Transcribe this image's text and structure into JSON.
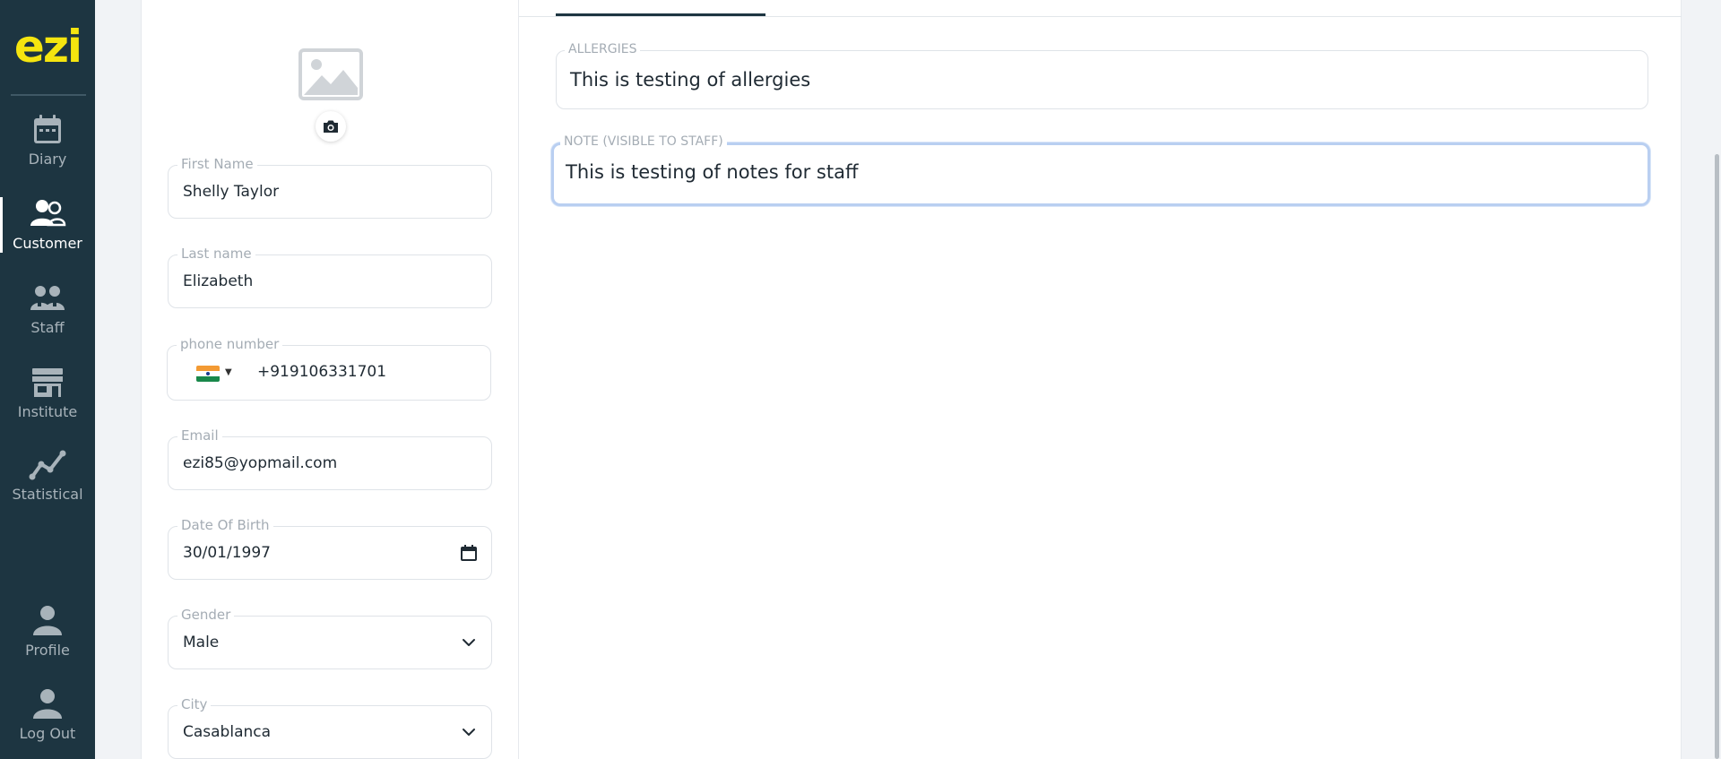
{
  "sidebar": {
    "logo": "ezi",
    "items": [
      {
        "label": "Diary",
        "icon": "calendar-icon",
        "active": false
      },
      {
        "label": "Customer",
        "icon": "users-icon",
        "active": true
      },
      {
        "label": "Staff",
        "icon": "staff-icon",
        "active": false
      },
      {
        "label": "Institute",
        "icon": "store-icon",
        "active": false
      },
      {
        "label": "Statistical",
        "icon": "chart-line-icon",
        "active": false
      },
      {
        "label": "Profile",
        "icon": "user-icon",
        "active": false
      },
      {
        "label": "Log Out",
        "icon": "user-icon",
        "active": false
      }
    ]
  },
  "customer_form": {
    "avatar_icon": "image-placeholder-icon",
    "camera_icon": "camera-icon",
    "first_name": {
      "label": "First Name",
      "value": "Shelly Taylor"
    },
    "last_name": {
      "label": "Last name",
      "value": "Elizabeth"
    },
    "phone": {
      "label": "phone number",
      "country_flag": "india-flag-icon",
      "value": "+919106331701"
    },
    "email": {
      "label": "Email",
      "value": "ezi85@yopmail.com"
    },
    "dob": {
      "label": "Date Of Birth",
      "value": "30/01/1997",
      "icon": "calendar-icon"
    },
    "gender": {
      "label": "Gender",
      "value": "Male",
      "icon": "chevron-down-icon"
    },
    "city": {
      "label": "City",
      "value": "Casablanca",
      "icon": "chevron-down-icon"
    }
  },
  "notes_panel": {
    "allergies": {
      "label": "ALLERGIES",
      "value": "This is testing of allergies"
    },
    "staff_note": {
      "label": "NOTE (VISIBLE TO STAFF)",
      "value": "This is testing of notes for staff",
      "focused": true
    }
  },
  "colors": {
    "sidebar_bg": "#1d3541",
    "logo": "#f5e50f",
    "focus_ring": "#b9cff1"
  }
}
